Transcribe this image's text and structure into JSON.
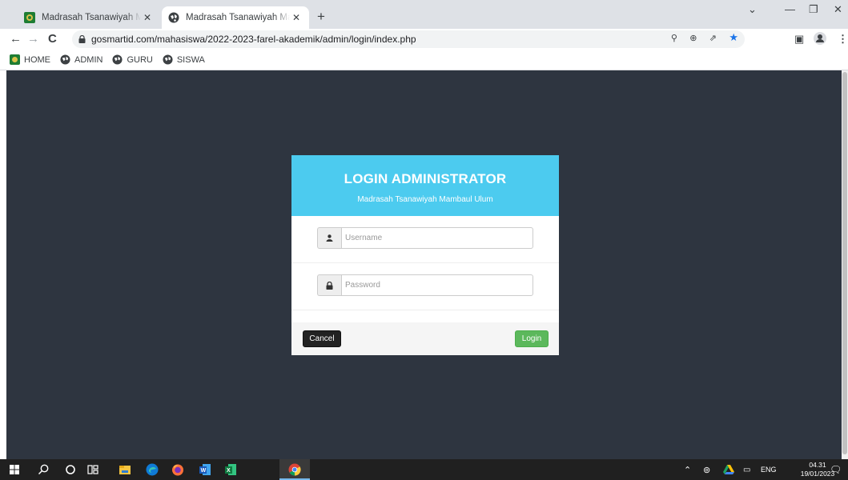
{
  "browser": {
    "tabs": [
      {
        "title": "Madrasah Tsanawiyah Mambaul Ulum",
        "active": false
      },
      {
        "title": "Madrasah Tsanawiyah Mambaul Ulum",
        "active": true
      }
    ],
    "url": "gosmartid.com/mahasiswa/2022-2023-farel-akademik/admin/login/index.php",
    "bookmarks": [
      "HOME",
      "ADMIN",
      "GURU",
      "SISWA"
    ]
  },
  "login": {
    "title": "LOGIN ADMINISTRATOR",
    "subtitle": "Madrasah Tsanawiyah Mambaul Ulum",
    "username_placeholder": "Username",
    "password_placeholder": "Password",
    "cancel_label": "Cancel",
    "login_label": "Login"
  },
  "taskbar": {
    "language": "ENG",
    "time": "04.31",
    "date": "19/01/2023"
  },
  "colors": {
    "header": "#4ccbef",
    "page_background": "#2e3540",
    "login_button": "#5cb85c",
    "cancel_button": "#222222"
  }
}
